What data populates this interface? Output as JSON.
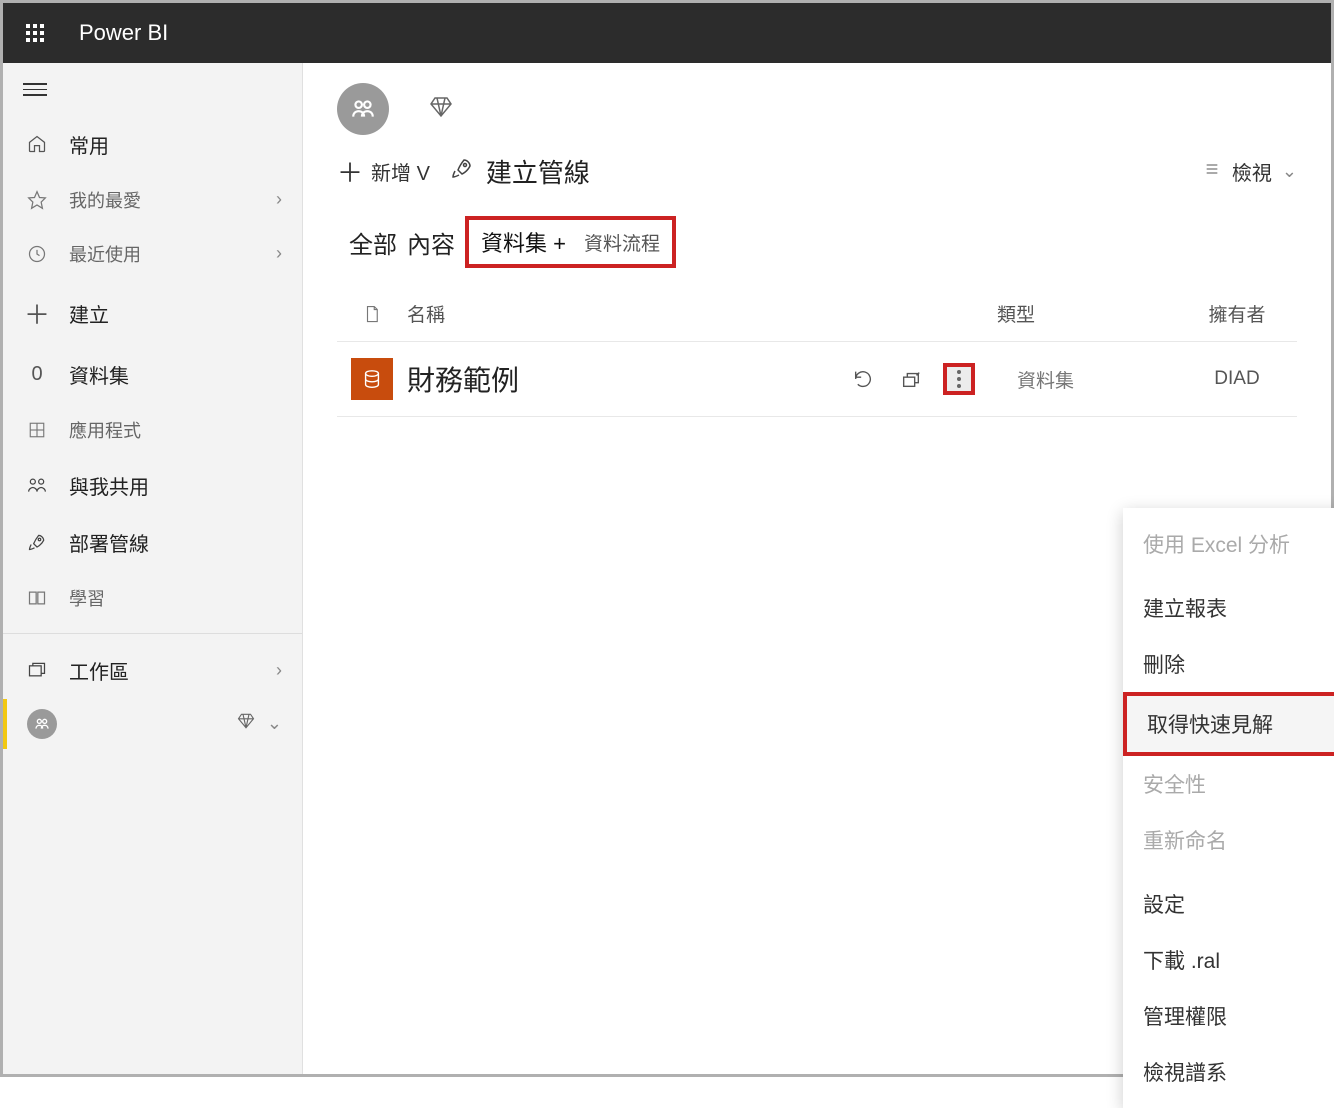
{
  "brand": "Power BI",
  "sidebar": {
    "items": [
      {
        "icon": "home",
        "label": "常用"
      },
      {
        "icon": "star",
        "label": "我的最愛",
        "chevron": true
      },
      {
        "icon": "clock",
        "label": "最近使用",
        "chevron": true
      },
      {
        "icon": "plus",
        "label": "建立"
      },
      {
        "icon": "zero",
        "label": "資料集"
      },
      {
        "icon": "grid",
        "label": "應用程式"
      },
      {
        "icon": "share",
        "label": "與我共用"
      },
      {
        "icon": "rocket",
        "label": "部署管線"
      },
      {
        "icon": "book",
        "label": "學習"
      }
    ],
    "workspaces_label": "工作區"
  },
  "toolbar": {
    "new_label": "新增 V",
    "pipeline_label": "建立管線",
    "view_label": "檢視"
  },
  "tabs": {
    "all": "全部",
    "content": "內容",
    "datasets": "資料集 +",
    "dataflows": "資料流程"
  },
  "columns": {
    "name": "名稱",
    "type": "類型",
    "owner": "擁有者"
  },
  "row": {
    "name": "財務範例",
    "type": "資料集",
    "owner": "DIAD"
  },
  "menu": {
    "analyze_excel": "使用 Excel 分析",
    "create_report": "建立報表",
    "delete": "刪除",
    "quick_insights": "取得快速見解",
    "security": "安全性",
    "rename": "重新命名",
    "settings": "設定",
    "download": "下載 .ral",
    "manage_permissions": "管理權限",
    "view_lineage": "檢視譜系"
  }
}
